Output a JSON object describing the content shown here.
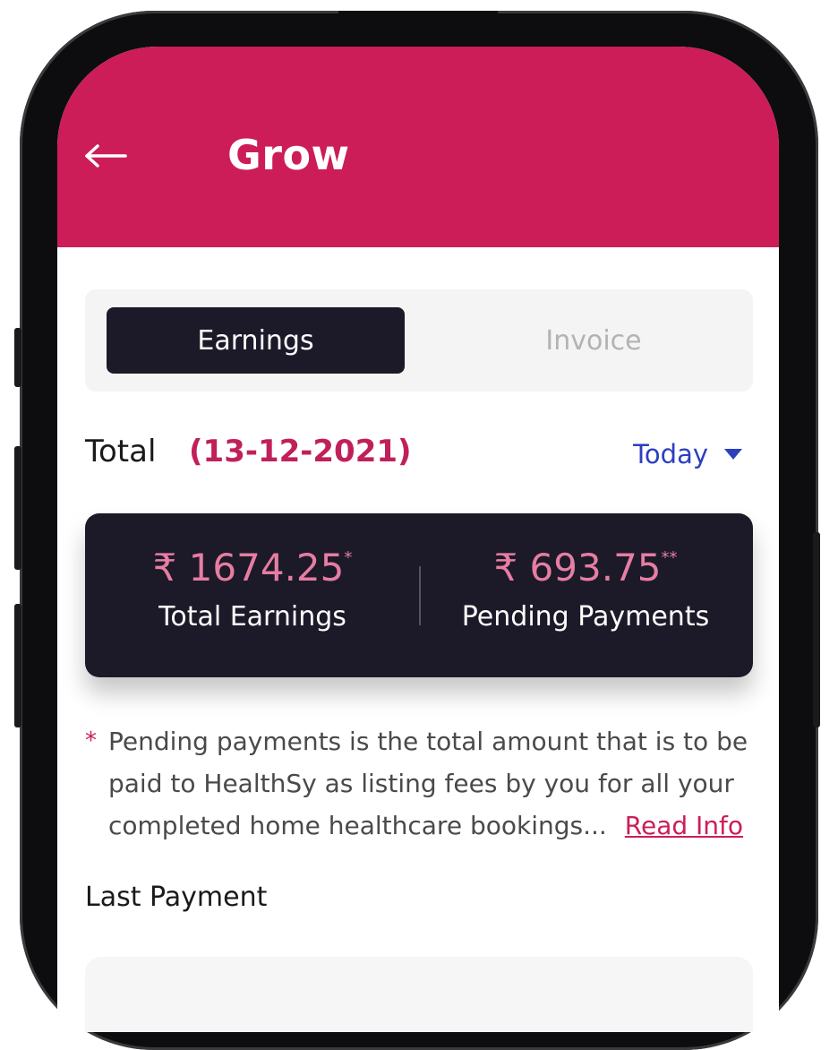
{
  "header": {
    "back_icon": "arrow-left-icon",
    "title": "Grow",
    "color": "#cc1d58"
  },
  "tabs": {
    "earnings": "Earnings",
    "invoice": "Invoice",
    "active": "Earnings"
  },
  "total": {
    "label": "Total",
    "date": "(13-12-2021)",
    "filter_label": "Today",
    "filter_icon": "caret-down-icon"
  },
  "summary": {
    "total_earnings": {
      "amount": "₹ 1674.25",
      "mark": "*",
      "label": "Total Earnings"
    },
    "pending_payments": {
      "amount": "₹ 693.75",
      "mark": "**",
      "label": "Pending Payments"
    }
  },
  "note": {
    "marker": "*",
    "text": "Pending payments is the total amount that is to be paid to HealthSy as listing fees by you for all your completed home healthcare bookings...",
    "link": "Read Info"
  },
  "last_payment": {
    "label": "Last Payment"
  },
  "colors": {
    "accent": "#cc1d58",
    "card_dark": "#1c1a28",
    "amount_pink": "#e77da3",
    "link_blue": "#2c3fbf"
  }
}
